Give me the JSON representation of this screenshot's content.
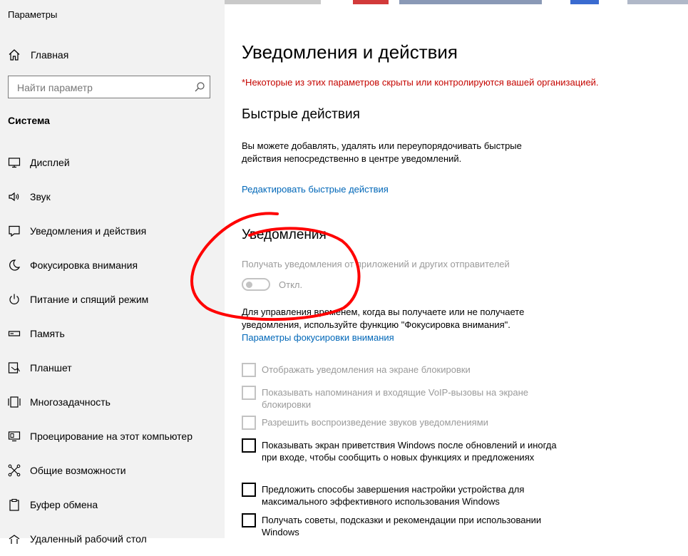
{
  "window": {
    "title": "Параметры"
  },
  "sidebar": {
    "home": {
      "label": "Главная",
      "icon": "home-icon"
    },
    "search": {
      "placeholder": "Найти параметр",
      "icon": "search-icon"
    },
    "section": "Система",
    "items": [
      {
        "label": "Дисплей",
        "icon": "display-icon"
      },
      {
        "label": "Звук",
        "icon": "sound-icon"
      },
      {
        "label": "Уведомления и действия",
        "icon": "notifications-icon"
      },
      {
        "label": "Фокусировка внимания",
        "icon": "moon-icon"
      },
      {
        "label": "Питание и спящий режим",
        "icon": "power-icon"
      },
      {
        "label": "Память",
        "icon": "storage-icon"
      },
      {
        "label": "Планшет",
        "icon": "tablet-icon"
      },
      {
        "label": "Многозадачность",
        "icon": "multitasking-icon"
      },
      {
        "label": "Проецирование на этот компьютер",
        "icon": "projecting-icon"
      },
      {
        "label": "Общие возможности",
        "icon": "shared-experiences-icon"
      },
      {
        "label": "Буфер обмена",
        "icon": "clipboard-icon"
      },
      {
        "label": "Удаленный рабочий стол",
        "icon": "remote-desktop-icon"
      }
    ]
  },
  "main": {
    "title": "Уведомления и действия",
    "warning": "*Некоторые из этих параметров скрыты или контролируются вашей организацией.",
    "quick_actions": {
      "heading": "Быстрые действия",
      "description": "Вы можете добавлять, удалять или переупорядочивать быстрые действия непосредственно в центре уведомлений.",
      "edit_link": "Редактировать быстрые действия"
    },
    "notifications": {
      "heading": "Уведомления",
      "toggle_label": "Получать уведомления от приложений и других отправителей",
      "toggle_state": "Откл.",
      "focus_description": "Для управления временем, когда вы получаете или не получаете уведомления, используйте функцию \"Фокусировка внимания\".",
      "focus_link": "Параметры фокусировки внимания"
    },
    "checkboxes": [
      {
        "label": "Отображать уведомления на экране блокировки",
        "disabled": true,
        "checked": false
      },
      {
        "label": "Показывать напоминания и входящие VoIP-вызовы на экране блокировки",
        "disabled": true,
        "checked": false
      },
      {
        "label": "Разрешить  воспроизведение звуков уведомлениями",
        "disabled": true,
        "checked": false
      },
      {
        "label": "Показывать экран приветствия Windows после обновлений и иногда при входе, чтобы сообщить о новых функциях и предложениях",
        "disabled": false,
        "checked": false
      },
      {
        "label": "Предложить способы завершения настройки устройства для максимального эффективного использования Windows",
        "disabled": false,
        "checked": false
      },
      {
        "label": "Получать советы, подсказки и рекомендации при использовании Windows",
        "disabled": false,
        "checked": false
      }
    ]
  },
  "colors": {
    "warning": "#c50500",
    "link": "#0067b8",
    "annotation": "#ff0000",
    "sidebar_bg": "#f2f2f2"
  }
}
